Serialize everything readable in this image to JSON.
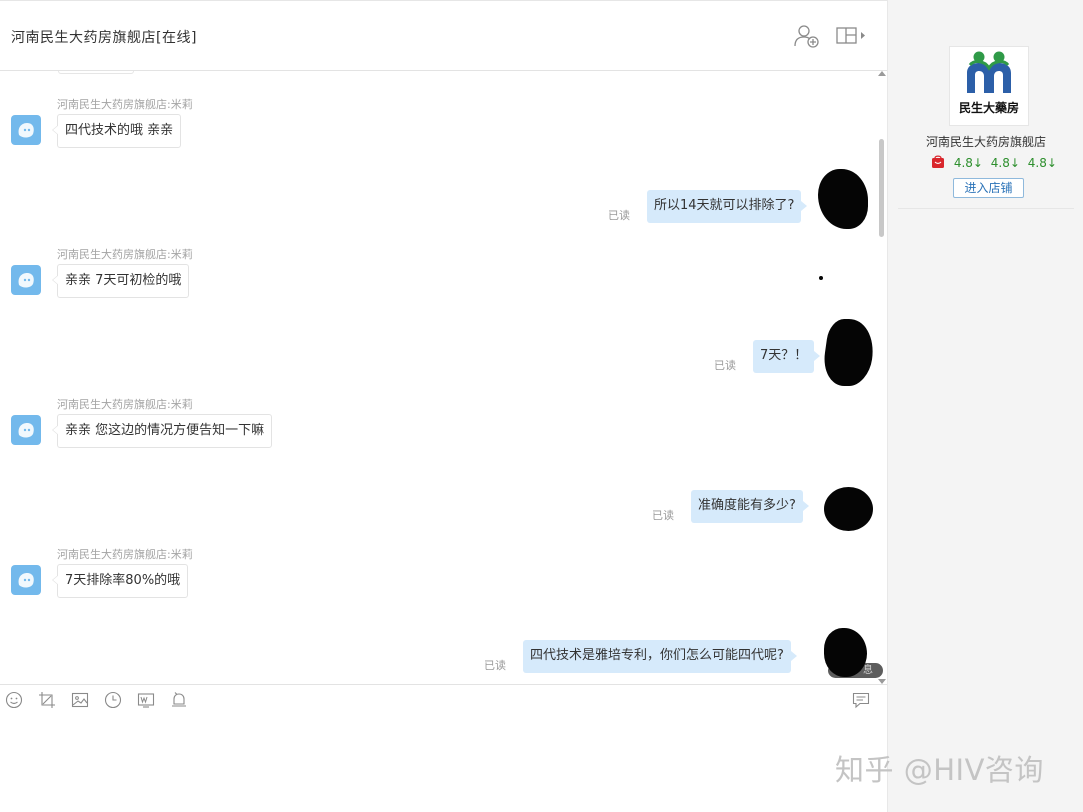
{
  "header": {
    "title": "河南民生大药房旗舰店[在线]"
  },
  "messages": [
    {
      "kind": "in",
      "sender": "河南民生大药房旗舰店:米莉",
      "text": "四代技术的哦  亲亲"
    },
    {
      "kind": "out",
      "text": "所以14天就可以排除了?",
      "status": "已读"
    },
    {
      "kind": "in",
      "sender": "河南民生大药房旗舰店:米莉",
      "text": "亲亲  7天可初检的哦"
    },
    {
      "kind": "out",
      "text": "7天？！",
      "status": "已读"
    },
    {
      "kind": "in",
      "sender": "河南民生大药房旗舰店:米莉",
      "text": "亲亲 您这边的情况方便告知一下嘛"
    },
    {
      "kind": "out",
      "text": "准确度能有多少?",
      "status": "已读"
    },
    {
      "kind": "in",
      "sender": "河南民生大药房旗舰店:米莉",
      "text": "7天排除率80%的哦"
    },
    {
      "kind": "out",
      "text": "四代技术是雅培专利，你们怎么可能四代呢?",
      "status": "已读"
    }
  ],
  "new_message_pill": "息",
  "toolbar": {
    "icons": [
      "emoji-icon",
      "screenshot-icon",
      "image-icon",
      "history-clock-icon",
      "video-icon",
      "bell-icon",
      "quick-reply-icon"
    ]
  },
  "side": {
    "logo_text": "民生大藥房",
    "shop_name": "河南民生大药房旗舰店",
    "ratings": [
      "4.8↓",
      "4.8↓",
      "4.8↓"
    ],
    "enter_store": "进入店铺"
  },
  "watermark": "知乎 @HIV咨询",
  "colors": {
    "outgoing_bubble": "#d6eafb",
    "avatar": "#73b9ec",
    "rating": "#2d8f2d",
    "link": "#2b73b8"
  }
}
